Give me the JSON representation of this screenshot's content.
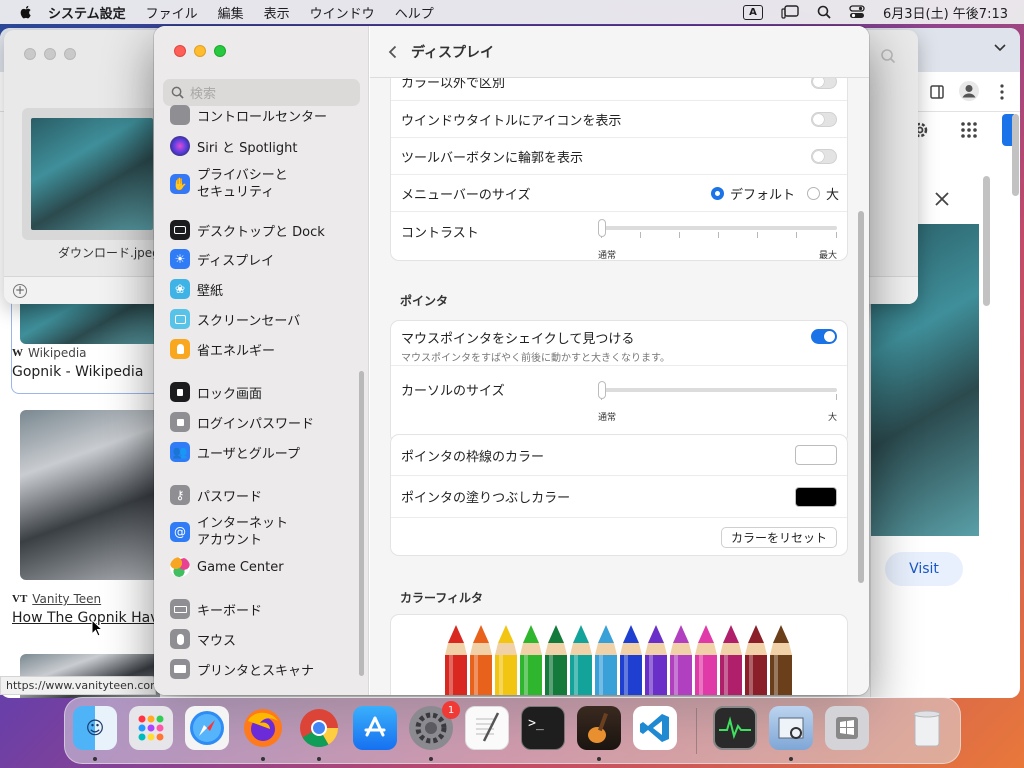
{
  "menubar": {
    "app_name": "システム設定",
    "items": [
      "ファイル",
      "編集",
      "表示",
      "ウインドウ",
      "ヘルプ"
    ],
    "input_indicator": "A",
    "clock": "6月3日(土) 午後7:13"
  },
  "browser": {
    "results": [
      {
        "source": "Wikipedia",
        "title": "Gopnik - Wikipedia"
      },
      {
        "source": "Vanity Teen",
        "title": "How The Gopnik Hav"
      }
    ],
    "visit_label": "Visit",
    "status_url": "https://www.vanityteen.com"
  },
  "preview": {
    "filename": "ダウンロード.jpeg"
  },
  "settings": {
    "search_placeholder": "検索",
    "sidebar": [
      {
        "label": "コントロールセンター",
        "icon": "control-center-icon"
      },
      {
        "label": "Siri と Spotlight",
        "icon": "siri-icon"
      },
      {
        "label": "プライバシーと",
        "label2": "セキュリティ",
        "icon": "privacy-hand-icon"
      },
      {
        "label": "デスクトップと Dock",
        "icon": "desktop-dock-icon"
      },
      {
        "label": "ディスプレイ",
        "icon": "display-sun-icon"
      },
      {
        "label": "壁紙",
        "icon": "wallpaper-icon"
      },
      {
        "label": "スクリーンセーバ",
        "icon": "screensaver-icon"
      },
      {
        "label": "省エネルギー",
        "icon": "energy-bulb-icon"
      },
      {
        "label": "ロック画面",
        "icon": "lock-screen-icon"
      },
      {
        "label": "ログインパスワード",
        "icon": "login-lock-icon"
      },
      {
        "label": "ユーザとグループ",
        "icon": "users-icon"
      },
      {
        "label": "パスワード",
        "icon": "key-icon"
      },
      {
        "label": "インターネット",
        "label2": "アカウント",
        "icon": "at-icon"
      },
      {
        "label": "Game Center",
        "icon": "game-center-icon"
      },
      {
        "label": "キーボード",
        "icon": "keyboard-icon"
      },
      {
        "label": "マウス",
        "icon": "mouse-icon"
      },
      {
        "label": "プリンタとスキャナ",
        "icon": "printer-icon"
      }
    ],
    "page_title": "ディスプレイ",
    "display_rows": {
      "color_distinction": "カラー以外で区別",
      "window_title_icons": "ウインドウタイトルにアイコンを表示",
      "toolbar_button_shapes": "ツールバーボタンに輪郭を表示",
      "menubar_size": "メニューバーのサイズ",
      "menubar_default": "デフォルト",
      "menubar_large": "大",
      "contrast": "コントラスト",
      "contrast_min": "通常",
      "contrast_max": "最大"
    },
    "pointer_section": "ポインタ",
    "pointer": {
      "shake_title": "マウスポインタをシェイクして見つける",
      "shake_desc": "マウスポインタをすばやく前後に動かすと大きくなります。",
      "cursor_size": "カーソルのサイズ",
      "cursor_min": "通常",
      "cursor_max": "大",
      "outline_color": "ポインタの枠線のカラー",
      "fill_color": "ポインタの塗りつぶしカラー",
      "reset_label": "カラーをリセット"
    },
    "color_filter_section": "カラーフィルタ",
    "toggles": {
      "color_distinction": false,
      "window_title_icons": false,
      "toolbar_button_shapes": false,
      "shake_to_locate": true
    },
    "menubar_size_selected": "デフォルト",
    "contrast_level": 0,
    "cursor_size_level": 0,
    "outline_color_value": "#ffffff",
    "fill_color_value": "#000000",
    "pencil_colors": [
      "#d8281f",
      "#e8621c",
      "#f2c512",
      "#2fb52e",
      "#137a3c",
      "#14a39a",
      "#3aa0d8",
      "#1f3fd0",
      "#6a2fc8",
      "#b040c0",
      "#e03aa8",
      "#b0206a",
      "#8a1f2a",
      "#6a3f1a"
    ]
  },
  "dock": {
    "apps": [
      "finder-icon",
      "launchpad-icon",
      "safari-icon",
      "firefox-icon",
      "chrome-icon",
      "app-store-icon",
      "system-settings-icon",
      "textedit-icon",
      "terminal-icon",
      "garageband-icon",
      "vscode-icon",
      "activity-monitor-icon",
      "preview-icon",
      "boot-camp-icon",
      "trash-icon"
    ],
    "settings_badge": "1"
  }
}
